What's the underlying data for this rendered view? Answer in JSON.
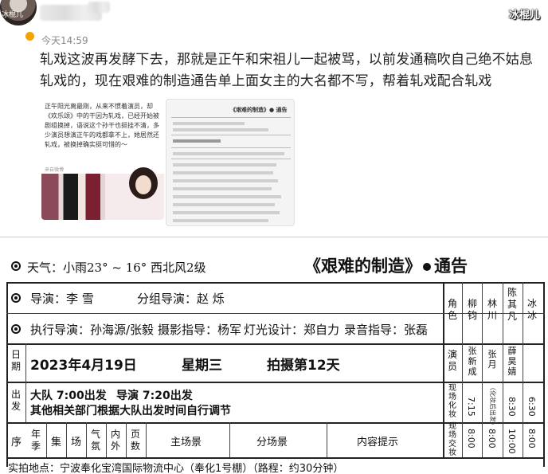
{
  "post": {
    "avatar_name": "冰棍儿",
    "watermark": "冰棍儿",
    "time": "今天14:59",
    "text": "轧戏这波再发酵下去，那就是正午和宋祖儿一起被骂，以前发通稿吹自己绝不姑息轧戏的，现在艰难的制造通告单上面女主的大名都不写，帮着轧戏配合轧戏",
    "thumb1_text": "正午阳光离最刚，从来不惯着演员，却《欢乐颂》中的干因为轧戏，已经开始被剧组换掉，语说这个孙干也挺挂不清，多少演员想演正午的戏都拿不上，她居然还轧戏，被换掉确实挺可惜的～",
    "thumb1_source": "来自微博",
    "thumb2_title": "《艰难的制造》● 通告"
  },
  "sheet": {
    "weather": "天气：小雨23° ~ 16° 西北风2级",
    "title": "《艰难的制造》",
    "notice": "通告",
    "director": "导演：李 雪",
    "sub_director": "分组导演：赵 烁",
    "exec_director": "执行导演：孙海源/张毅",
    "dop": "摄影指导：杨军",
    "lighting": "灯光设计：郑自力",
    "sound": "录音指导：张磊",
    "date_label": "日期",
    "date": "2023年4月19日",
    "weekday": "星期三",
    "shoot_day": "拍摄第12天",
    "depart_label": "出发",
    "team_depart": "大队 7:00出发",
    "director_depart": "导演 7:20出发",
    "other_depart": "其他相关部门根据大队出发时间自行调节",
    "headers": [
      "序",
      "年季",
      "集",
      "场",
      "气氛",
      "内外",
      "页数",
      "主场景",
      "分场景",
      "内容提示"
    ],
    "location": "实拍地点：宁波奉化宝湾国际物流中心（奉化1号棚）（路程：约30分钟）",
    "role_labels": {
      "role": "角色",
      "actor": "演员",
      "makeup": "现场化妆",
      "costume": "现场交妆"
    },
    "cast": [
      {
        "role": "柳钧",
        "actor": "张新成",
        "makeup": "7:15",
        "costume": "8:00"
      },
      {
        "role": "林川",
        "actor": "张月",
        "makeup": "（化妆后出发）",
        "costume": "8:00"
      },
      {
        "role": "陈其凡",
        "actor": "薛昊婧",
        "makeup": "8:30",
        "costume": "10:00"
      },
      {
        "role": "冰冰",
        "actor": "",
        "makeup": "6:30",
        "costume": "8:00"
      }
    ]
  }
}
